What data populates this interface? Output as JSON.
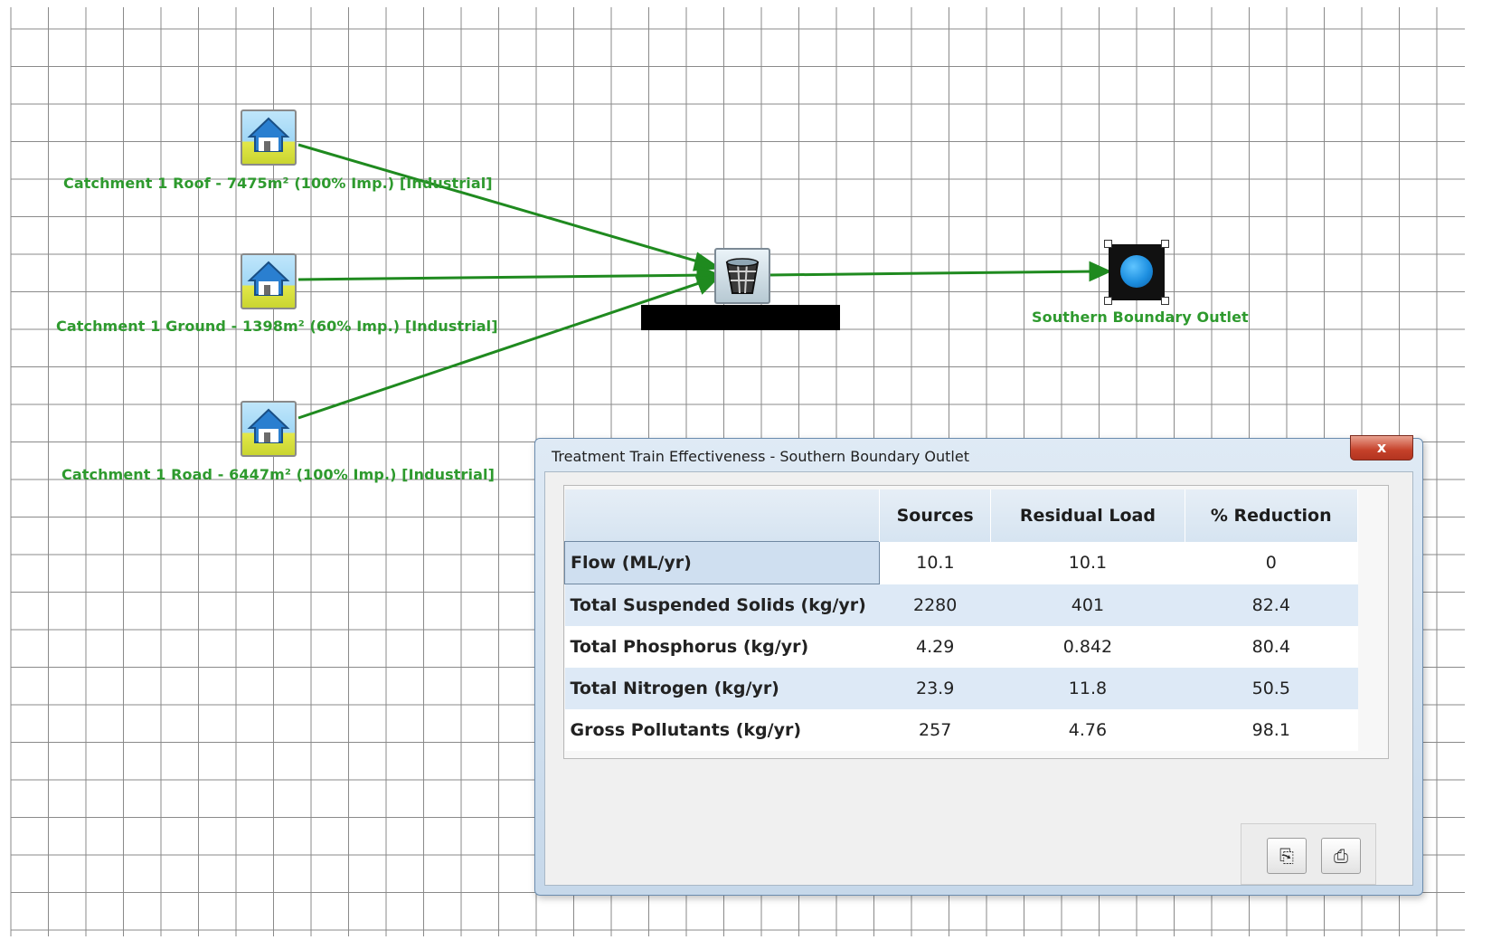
{
  "canvas": {
    "nodes": [
      {
        "label": "Catchment 1 Roof - 7475m² (100% Imp.) [Industrial]",
        "icon": "house-icon"
      },
      {
        "label": "Catchment 1 Ground - 1398m² (60% Imp.) [Industrial]",
        "icon": "house-icon"
      },
      {
        "label": "Catchment 1 Road - 6447m² (100% Imp.) [Industrial]",
        "icon": "house-icon"
      },
      {
        "label": "",
        "icon": "treatment-node-icon"
      },
      {
        "label": "Southern Boundary Outlet",
        "icon": "outlet-node-icon"
      }
    ],
    "link_color": "#1f8a1f",
    "label_color": "#2e9a2e"
  },
  "dialog": {
    "title": "Treatment Train Effectiveness - Southern Boundary Outlet",
    "close_label": "x",
    "columns": [
      "",
      "Sources",
      "Residual Load",
      "% Reduction"
    ],
    "rows": [
      {
        "label": "Flow (ML/yr)",
        "sources": "10.1",
        "residual": "10.1",
        "reduction": "0"
      },
      {
        "label": "Total Suspended Solids (kg/yr)",
        "sources": "2280",
        "residual": "401",
        "reduction": "82.4"
      },
      {
        "label": "Total Phosphorus (kg/yr)",
        "sources": "4.29",
        "residual": "0.842",
        "reduction": "80.4"
      },
      {
        "label": "Total Nitrogen (kg/yr)",
        "sources": "23.9",
        "residual": "11.8",
        "reduction": "50.5"
      },
      {
        "label": "Gross Pollutants (kg/yr)",
        "sources": "257",
        "residual": "4.76",
        "reduction": "98.1"
      }
    ],
    "buttons": [
      {
        "icon": "copy-icon",
        "glyph": "⎘"
      },
      {
        "icon": "print-icon",
        "glyph": "⎙"
      }
    ]
  }
}
